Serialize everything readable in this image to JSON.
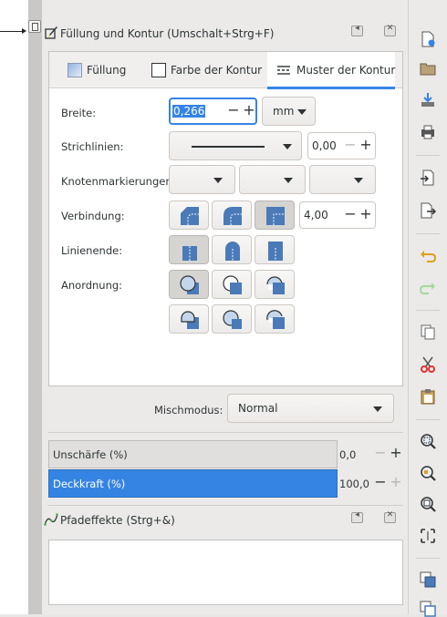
{
  "fill_stroke_dialog": {
    "title": "Füllung und Kontur (Umschalt+Strg+F)",
    "tabs": [
      {
        "label": "Füllung",
        "active": false
      },
      {
        "label": "Farbe der Kontur",
        "active": false
      },
      {
        "label": "Muster der Kontur",
        "active": true
      }
    ],
    "width": {
      "label": "Breite:",
      "value": "0,266",
      "unit": "mm"
    },
    "dashes": {
      "label": "Strichlinien:",
      "offset": "0,00"
    },
    "markers": {
      "label": "Knotenmarkierungen:"
    },
    "join": {
      "label": "Verbindung:",
      "miter_limit": "4,00",
      "buttons": [
        "join-bevel",
        "join-round",
        "join-miter"
      ],
      "selected": "join-miter"
    },
    "cap": {
      "label": "Linienende:",
      "buttons": [
        "cap-butt",
        "cap-round",
        "cap-square"
      ],
      "selected": "cap-butt"
    },
    "order": {
      "label": "Anordnung:",
      "selected": "order-normal"
    },
    "blend": {
      "label": "Mischmodus:",
      "value": "Normal"
    },
    "blur": {
      "label": "Unschärfe (%)",
      "value": "0,0"
    },
    "opacity": {
      "label": "Deckkraft (%)",
      "value": "100,0"
    }
  },
  "path_effects_dialog": {
    "title": "Pfadeffekte (Strg+&)"
  },
  "spin_glyphs": {
    "minus": "−",
    "plus": "+"
  },
  "header_glyphs": {
    "dock": "◂",
    "close": "✕"
  },
  "colors": {
    "accent": "#3584e4",
    "panel_bg": "#ebeae8",
    "icon_blue": "#4a7ab8"
  },
  "toolbar_icons": [
    "new-document-icon",
    "open-document-icon",
    "save-icon",
    "print-icon",
    "import-icon",
    "export-icon",
    "undo-icon",
    "redo-icon",
    "copy-icon",
    "cut-icon",
    "paste-icon",
    "zoom-selection-icon",
    "zoom-drawing-icon",
    "zoom-page-icon",
    "zoom-fit-width-icon",
    "duplicate-icon",
    "clone-icon"
  ]
}
